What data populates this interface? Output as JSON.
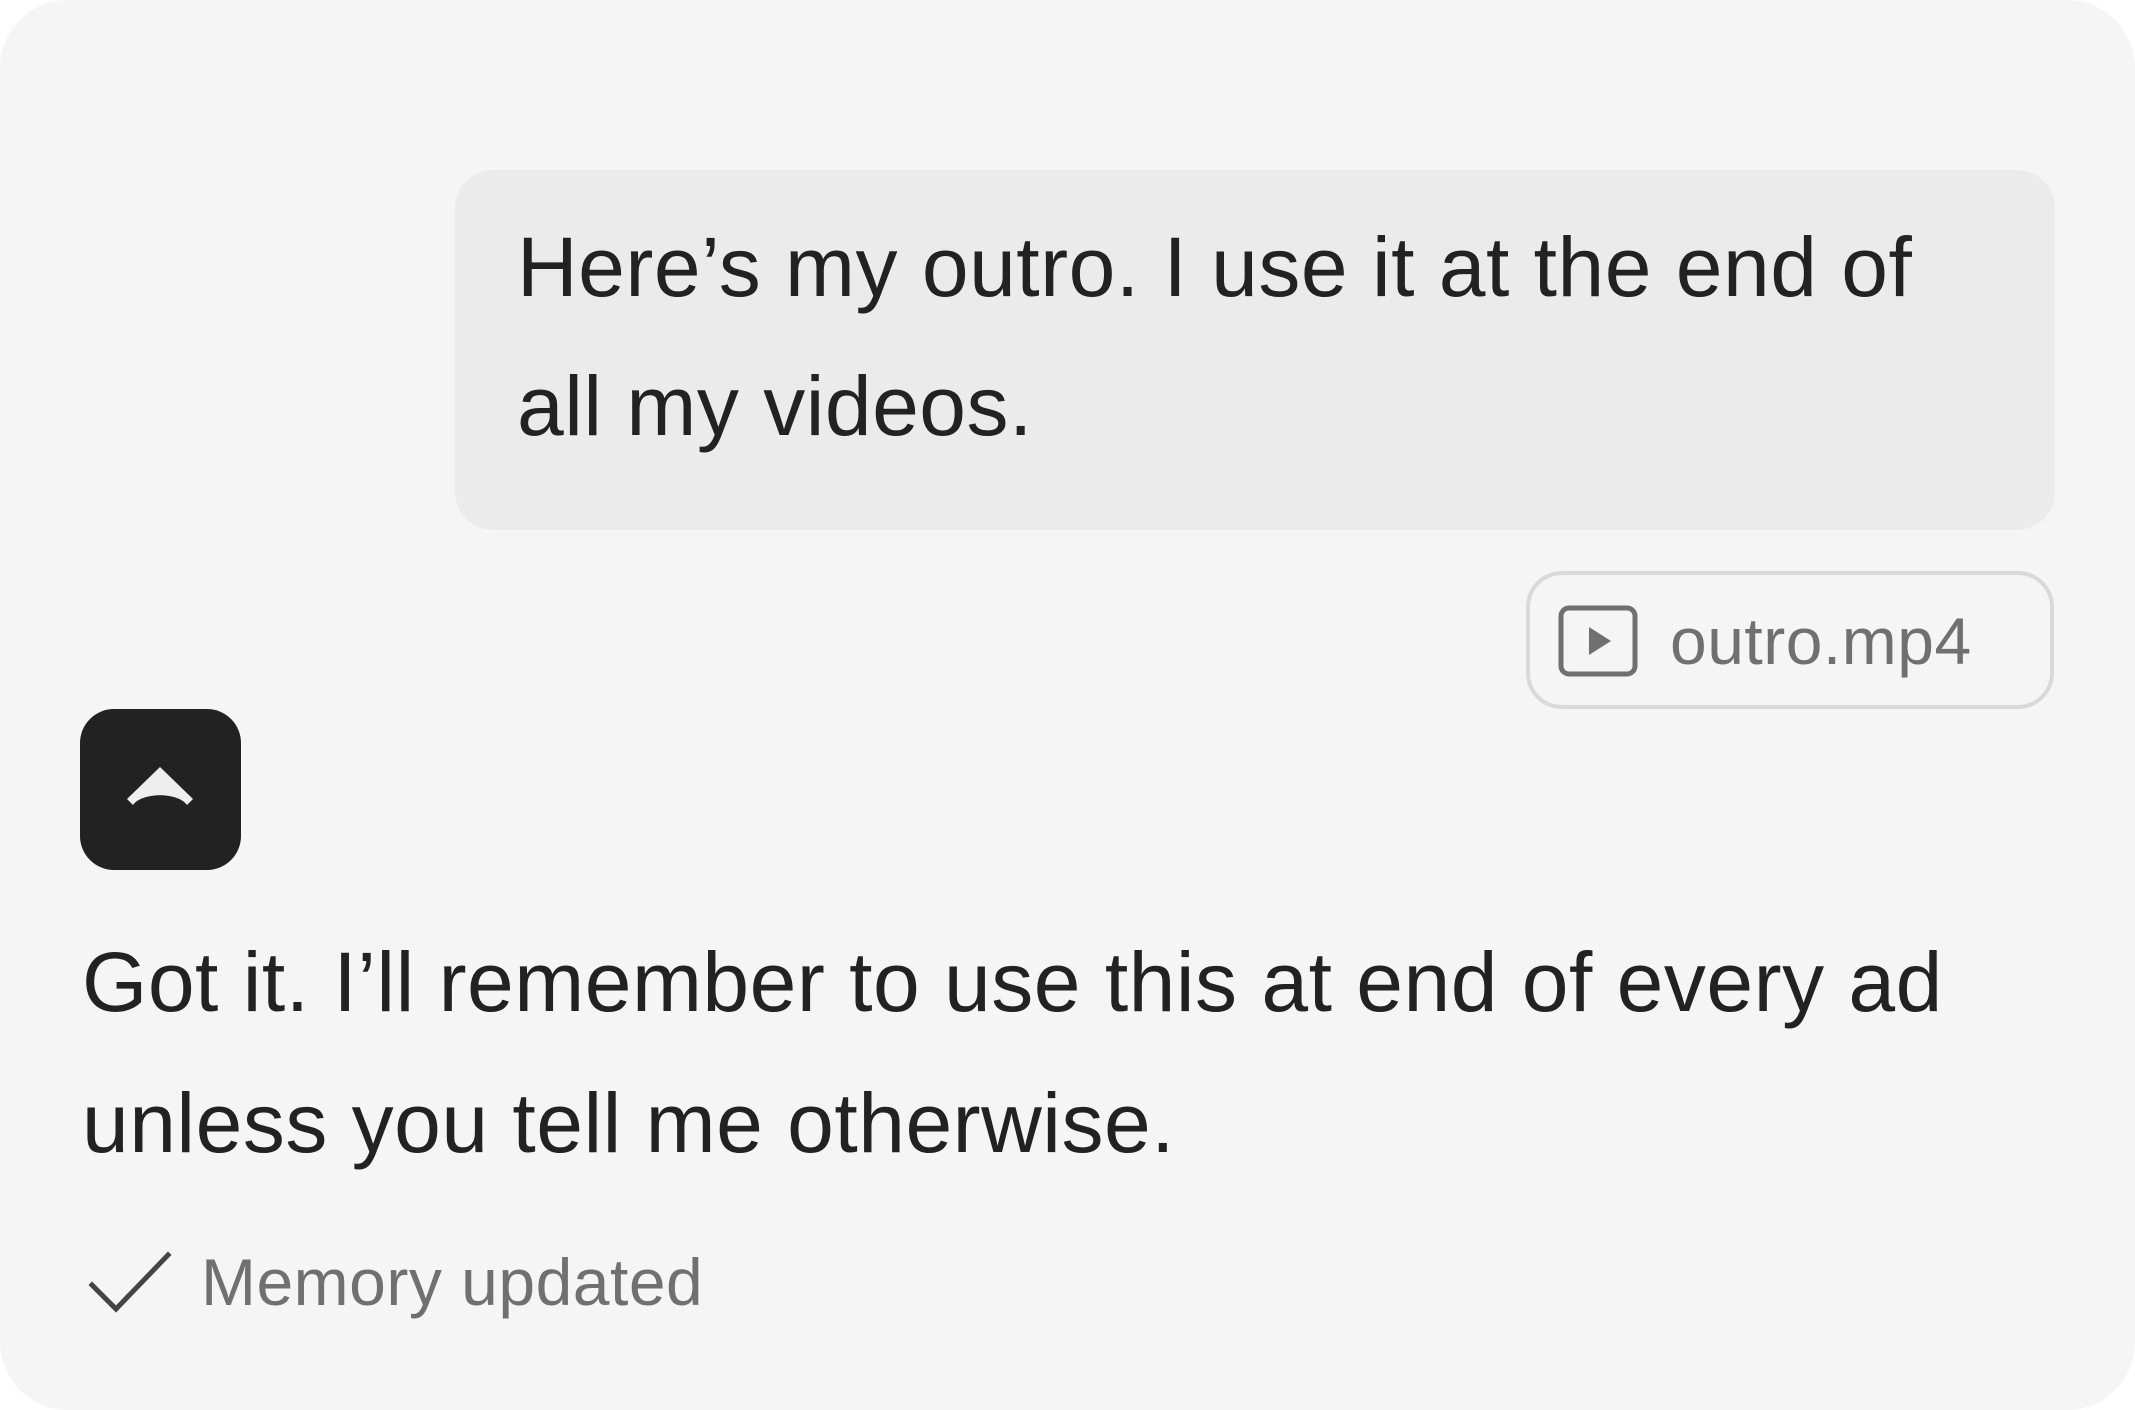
{
  "conversation": {
    "user_message": {
      "text": "Here’s my outro. I use it at the end of all my videos.",
      "attachment": {
        "file_name": "outro.mp4",
        "icon": "video-play-icon"
      }
    },
    "assistant_message": {
      "avatar_icon": "assistant-logo-icon",
      "text": "Got it. I’ll remember to use this at end of every ad unless you tell me otherwise.",
      "status": {
        "icon": "checkmark-icon",
        "label": "Memory updated"
      }
    }
  },
  "colors": {
    "background": "#f5f5f5",
    "user_bubble": "#ebebeb",
    "text": "#222222",
    "muted_text": "#707070",
    "avatar_background": "#222222",
    "attachment_border": "#d9d9d9"
  }
}
